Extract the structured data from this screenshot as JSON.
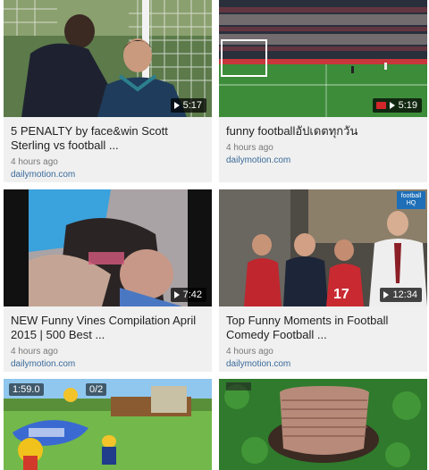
{
  "cards": [
    {
      "title": "5 PENALTY by face&win Scott Sterling vs football ...",
      "time": "4 hours ago",
      "source": "dailymotion.com",
      "duration": "5:17"
    },
    {
      "title": "funny footballอัปเดตทุกวัน",
      "time": "4 hours ago",
      "source": "dailymotion.com",
      "duration": "5:19"
    },
    {
      "title": "NEW Funny Vines Compilation April 2015 | 500 Best ...",
      "time": "4 hours ago",
      "source": "dailymotion.com",
      "duration": "7:42"
    },
    {
      "title": "Top Funny Moments in Football Comedy Football ...",
      "time": "4 hours ago",
      "source": "dailymotion.com",
      "duration": "12:34",
      "badge": "football HQ"
    },
    {
      "hud_left": "1:59.0",
      "hud_right": "0/2"
    },
    {}
  ],
  "colors": {
    "card_bg": "#f0f0f0",
    "title": "#222222",
    "meta": "#777777",
    "source": "#3a6a9a",
    "record_red": "#d3262b"
  }
}
